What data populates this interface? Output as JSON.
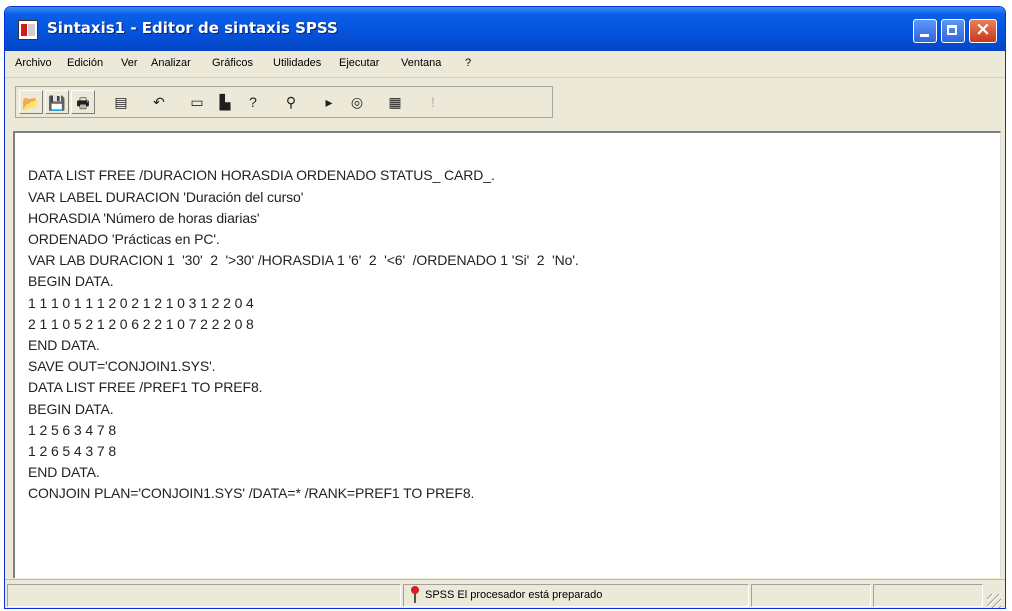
{
  "window": {
    "title": "Sintaxis1 - Editor de sintaxis SPSS"
  },
  "menu": [
    "Archivo",
    "Edición",
    "Ver",
    "Analizar",
    "Gráficos",
    "Utilidades",
    "Ejecutar",
    "Ventana",
    "?"
  ],
  "toolbar": [
    {
      "name": "open-icon",
      "glyph": "📂"
    },
    {
      "name": "save-icon",
      "glyph": "💾"
    },
    {
      "name": "print-icon",
      "glyph": "🖶"
    },
    {
      "name": "recall-dialog-icon",
      "glyph": "▤"
    },
    {
      "name": "undo-icon",
      "glyph": "↶"
    },
    {
      "name": "goto-case-icon",
      "glyph": "▭"
    },
    {
      "name": "variables-icon",
      "glyph": "▙"
    },
    {
      "name": "help-topics-icon",
      "glyph": "?"
    },
    {
      "name": "find-icon",
      "glyph": "⚲"
    },
    {
      "name": "run-icon",
      "glyph": "▸"
    },
    {
      "name": "use-sets-icon",
      "glyph": "◎"
    },
    {
      "name": "syntax-help-icon",
      "glyph": "▦"
    },
    {
      "name": "designate-window-icon",
      "glyph": "!"
    }
  ],
  "syntax_lines": [
    "DATA LIST FREE /DURACION HORASDIA ORDENADO STATUS_ CARD_.",
    "VAR LABEL DURACION 'Duración del curso'",
    "HORASDIA 'Número de horas diarias'",
    "ORDENADO 'Prácticas en PC'.",
    "VAR LAB DURACION 1  '30'  2  '>30' /HORASDIA 1 '6'  2  '<6'  /ORDENADO 1 'Si'  2  'No'.",
    "BEGIN DATA.",
    "1 1 1 0 1 1 1 2 0 2 1 2 1 0 3 1 2 2 0 4",
    "2 1 1 0 5 2 1 2 0 6 2 2 1 0 7 2 2 2 0 8",
    "END DATA.",
    "SAVE OUT='CONJOIN1.SYS'.",
    "DATA LIST FREE /PREF1 TO PREF8.",
    "BEGIN DATA.",
    "1 2 5 6 3 4 7 8",
    "1 2 6 5 4 3 7 8",
    "END DATA.",
    "CONJOIN PLAN='CONJOIN1.SYS' /DATA=* /RANK=PREF1 TO PREF8."
  ],
  "status": {
    "text": "SPSS El procesador  está preparado"
  },
  "colors": {
    "titlebar": "#0553dd",
    "chrome": "#ece9d8",
    "status_pin": "#d61f1f"
  }
}
